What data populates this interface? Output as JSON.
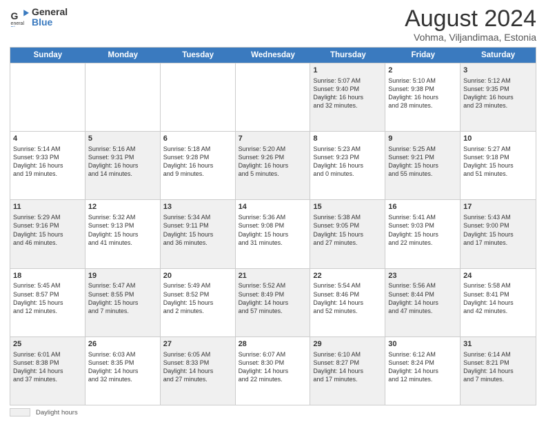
{
  "logo": {
    "line1": "General",
    "line2": "Blue"
  },
  "header": {
    "month": "August 2024",
    "location": "Vohma, Viljandimaa, Estonia"
  },
  "weekdays": [
    "Sunday",
    "Monday",
    "Tuesday",
    "Wednesday",
    "Thursday",
    "Friday",
    "Saturday"
  ],
  "footer": {
    "swatch_label": "Daylight hours"
  },
  "rows": [
    [
      {
        "day": "",
        "text": "",
        "shaded": false
      },
      {
        "day": "",
        "text": "",
        "shaded": false
      },
      {
        "day": "",
        "text": "",
        "shaded": false
      },
      {
        "day": "",
        "text": "",
        "shaded": false
      },
      {
        "day": "1",
        "text": "Sunrise: 5:07 AM\nSunset: 9:40 PM\nDaylight: 16 hours\nand 32 minutes.",
        "shaded": true
      },
      {
        "day": "2",
        "text": "Sunrise: 5:10 AM\nSunset: 9:38 PM\nDaylight: 16 hours\nand 28 minutes.",
        "shaded": false
      },
      {
        "day": "3",
        "text": "Sunrise: 5:12 AM\nSunset: 9:35 PM\nDaylight: 16 hours\nand 23 minutes.",
        "shaded": true
      }
    ],
    [
      {
        "day": "4",
        "text": "Sunrise: 5:14 AM\nSunset: 9:33 PM\nDaylight: 16 hours\nand 19 minutes.",
        "shaded": false
      },
      {
        "day": "5",
        "text": "Sunrise: 5:16 AM\nSunset: 9:31 PM\nDaylight: 16 hours\nand 14 minutes.",
        "shaded": true
      },
      {
        "day": "6",
        "text": "Sunrise: 5:18 AM\nSunset: 9:28 PM\nDaylight: 16 hours\nand 9 minutes.",
        "shaded": false
      },
      {
        "day": "7",
        "text": "Sunrise: 5:20 AM\nSunset: 9:26 PM\nDaylight: 16 hours\nand 5 minutes.",
        "shaded": true
      },
      {
        "day": "8",
        "text": "Sunrise: 5:23 AM\nSunset: 9:23 PM\nDaylight: 16 hours\nand 0 minutes.",
        "shaded": false
      },
      {
        "day": "9",
        "text": "Sunrise: 5:25 AM\nSunset: 9:21 PM\nDaylight: 15 hours\nand 55 minutes.",
        "shaded": true
      },
      {
        "day": "10",
        "text": "Sunrise: 5:27 AM\nSunset: 9:18 PM\nDaylight: 15 hours\nand 51 minutes.",
        "shaded": false
      }
    ],
    [
      {
        "day": "11",
        "text": "Sunrise: 5:29 AM\nSunset: 9:16 PM\nDaylight: 15 hours\nand 46 minutes.",
        "shaded": true
      },
      {
        "day": "12",
        "text": "Sunrise: 5:32 AM\nSunset: 9:13 PM\nDaylight: 15 hours\nand 41 minutes.",
        "shaded": false
      },
      {
        "day": "13",
        "text": "Sunrise: 5:34 AM\nSunset: 9:11 PM\nDaylight: 15 hours\nand 36 minutes.",
        "shaded": true
      },
      {
        "day": "14",
        "text": "Sunrise: 5:36 AM\nSunset: 9:08 PM\nDaylight: 15 hours\nand 31 minutes.",
        "shaded": false
      },
      {
        "day": "15",
        "text": "Sunrise: 5:38 AM\nSunset: 9:05 PM\nDaylight: 15 hours\nand 27 minutes.",
        "shaded": true
      },
      {
        "day": "16",
        "text": "Sunrise: 5:41 AM\nSunset: 9:03 PM\nDaylight: 15 hours\nand 22 minutes.",
        "shaded": false
      },
      {
        "day": "17",
        "text": "Sunrise: 5:43 AM\nSunset: 9:00 PM\nDaylight: 15 hours\nand 17 minutes.",
        "shaded": true
      }
    ],
    [
      {
        "day": "18",
        "text": "Sunrise: 5:45 AM\nSunset: 8:57 PM\nDaylight: 15 hours\nand 12 minutes.",
        "shaded": false
      },
      {
        "day": "19",
        "text": "Sunrise: 5:47 AM\nSunset: 8:55 PM\nDaylight: 15 hours\nand 7 minutes.",
        "shaded": true
      },
      {
        "day": "20",
        "text": "Sunrise: 5:49 AM\nSunset: 8:52 PM\nDaylight: 15 hours\nand 2 minutes.",
        "shaded": false
      },
      {
        "day": "21",
        "text": "Sunrise: 5:52 AM\nSunset: 8:49 PM\nDaylight: 14 hours\nand 57 minutes.",
        "shaded": true
      },
      {
        "day": "22",
        "text": "Sunrise: 5:54 AM\nSunset: 8:46 PM\nDaylight: 14 hours\nand 52 minutes.",
        "shaded": false
      },
      {
        "day": "23",
        "text": "Sunrise: 5:56 AM\nSunset: 8:44 PM\nDaylight: 14 hours\nand 47 minutes.",
        "shaded": true
      },
      {
        "day": "24",
        "text": "Sunrise: 5:58 AM\nSunset: 8:41 PM\nDaylight: 14 hours\nand 42 minutes.",
        "shaded": false
      }
    ],
    [
      {
        "day": "25",
        "text": "Sunrise: 6:01 AM\nSunset: 8:38 PM\nDaylight: 14 hours\nand 37 minutes.",
        "shaded": true
      },
      {
        "day": "26",
        "text": "Sunrise: 6:03 AM\nSunset: 8:35 PM\nDaylight: 14 hours\nand 32 minutes.",
        "shaded": false
      },
      {
        "day": "27",
        "text": "Sunrise: 6:05 AM\nSunset: 8:33 PM\nDaylight: 14 hours\nand 27 minutes.",
        "shaded": true
      },
      {
        "day": "28",
        "text": "Sunrise: 6:07 AM\nSunset: 8:30 PM\nDaylight: 14 hours\nand 22 minutes.",
        "shaded": false
      },
      {
        "day": "29",
        "text": "Sunrise: 6:10 AM\nSunset: 8:27 PM\nDaylight: 14 hours\nand 17 minutes.",
        "shaded": true
      },
      {
        "day": "30",
        "text": "Sunrise: 6:12 AM\nSunset: 8:24 PM\nDaylight: 14 hours\nand 12 minutes.",
        "shaded": false
      },
      {
        "day": "31",
        "text": "Sunrise: 6:14 AM\nSunset: 8:21 PM\nDaylight: 14 hours\nand 7 minutes.",
        "shaded": true
      }
    ]
  ]
}
